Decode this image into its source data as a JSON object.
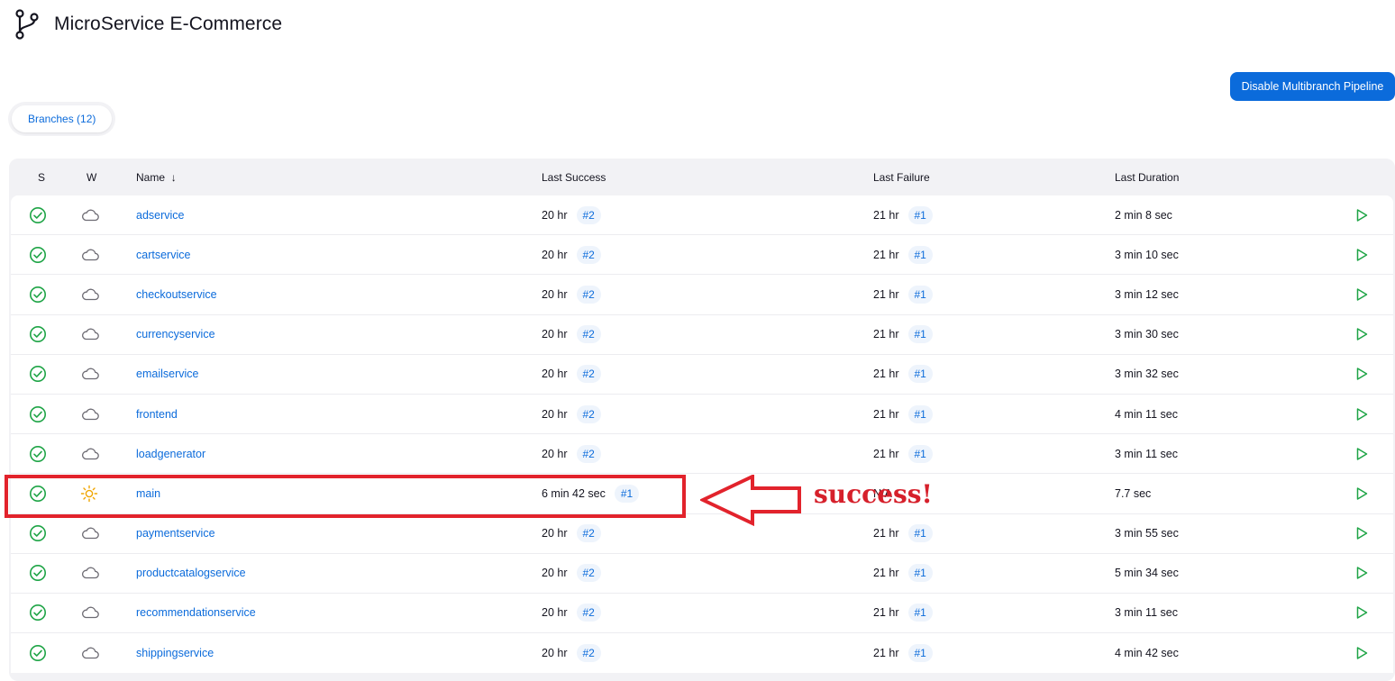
{
  "page": {
    "title": "MicroService E-Commerce",
    "disable_button": "Disable Multibranch Pipeline",
    "tab_label": "Branches (12)",
    "brand_color": "#0b6bdb"
  },
  "table": {
    "headers": {
      "s": "S",
      "w": "W",
      "name": "Name",
      "sort_indicator": "↓",
      "last_success": "Last Success",
      "last_failure": "Last Failure",
      "last_duration": "Last Duration"
    },
    "rows": [
      {
        "status": "success",
        "weather": "cloudy",
        "name": "adservice",
        "last_success": "20 hr",
        "success_build": "#2",
        "last_failure": "21 hr",
        "failure_build": "#1",
        "duration": "2 min 8 sec"
      },
      {
        "status": "success",
        "weather": "cloudy",
        "name": "cartservice",
        "last_success": "20 hr",
        "success_build": "#2",
        "last_failure": "21 hr",
        "failure_build": "#1",
        "duration": "3 min 10 sec"
      },
      {
        "status": "success",
        "weather": "cloudy",
        "name": "checkoutservice",
        "last_success": "20 hr",
        "success_build": "#2",
        "last_failure": "21 hr",
        "failure_build": "#1",
        "duration": "3 min 12 sec"
      },
      {
        "status": "success",
        "weather": "cloudy",
        "name": "currencyservice",
        "last_success": "20 hr",
        "success_build": "#2",
        "last_failure": "21 hr",
        "failure_build": "#1",
        "duration": "3 min 30 sec"
      },
      {
        "status": "success",
        "weather": "cloudy",
        "name": "emailservice",
        "last_success": "20 hr",
        "success_build": "#2",
        "last_failure": "21 hr",
        "failure_build": "#1",
        "duration": "3 min 32 sec"
      },
      {
        "status": "success",
        "weather": "cloudy",
        "name": "frontend",
        "last_success": "20 hr",
        "success_build": "#2",
        "last_failure": "21 hr",
        "failure_build": "#1",
        "duration": "4 min 11 sec"
      },
      {
        "status": "success",
        "weather": "cloudy",
        "name": "loadgenerator",
        "last_success": "20 hr",
        "success_build": "#2",
        "last_failure": "21 hr",
        "failure_build": "#1",
        "duration": "3 min 11 sec"
      },
      {
        "status": "success",
        "weather": "sunny",
        "name": "main",
        "last_success": "6 min 42 sec",
        "success_build": "#1",
        "last_failure": "N/A",
        "failure_build": "",
        "duration": "7.7 sec"
      },
      {
        "status": "success",
        "weather": "cloudy",
        "name": "paymentservice",
        "last_success": "20 hr",
        "success_build": "#2",
        "last_failure": "21 hr",
        "failure_build": "#1",
        "duration": "3 min 55 sec"
      },
      {
        "status": "success",
        "weather": "cloudy",
        "name": "productcatalogservice",
        "last_success": "20 hr",
        "success_build": "#2",
        "last_failure": "21 hr",
        "failure_build": "#1",
        "duration": "5 min 34 sec"
      },
      {
        "status": "success",
        "weather": "cloudy",
        "name": "recommendationservice",
        "last_success": "20 hr",
        "success_build": "#2",
        "last_failure": "21 hr",
        "failure_build": "#1",
        "duration": "3 min 11 sec"
      },
      {
        "status": "success",
        "weather": "cloudy",
        "name": "shippingservice",
        "last_success": "20 hr",
        "success_build": "#2",
        "last_failure": "21 hr",
        "failure_build": "#1",
        "duration": "4 min 42 sec"
      }
    ]
  },
  "annotation": {
    "text": "success!",
    "color": "#e2232c"
  },
  "icons": {
    "logo": "git-branch-icon",
    "status": "check-circle-icon",
    "weather_cloudy": "cloud-icon",
    "weather_sunny": "sun-icon",
    "run": "play-icon"
  }
}
